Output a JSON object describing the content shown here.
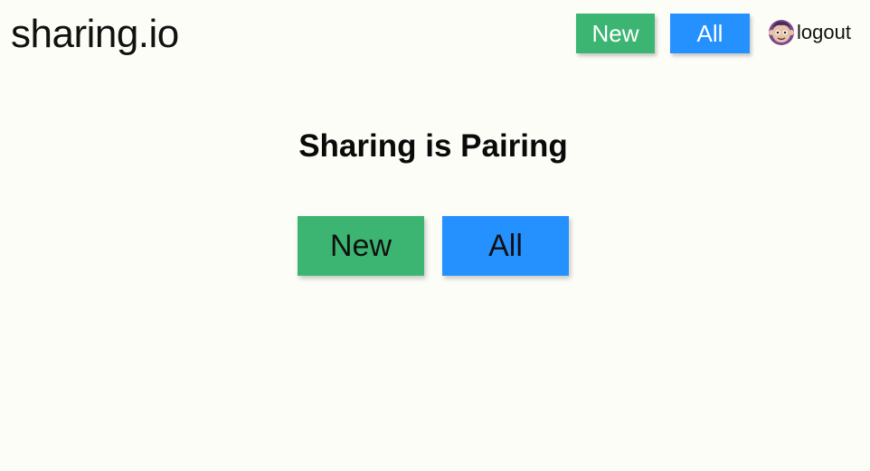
{
  "header": {
    "brand": "sharing.io",
    "nav": {
      "new_label": "New",
      "all_label": "All"
    },
    "logout_label": "logout",
    "avatar_icon": "octocat-avatar-icon"
  },
  "main": {
    "title": "Sharing is Pairing",
    "new_label": "New",
    "all_label": "All"
  },
  "colors": {
    "background": "#fdfdf7",
    "new_button": "#3db572",
    "all_button": "#2491ff"
  }
}
